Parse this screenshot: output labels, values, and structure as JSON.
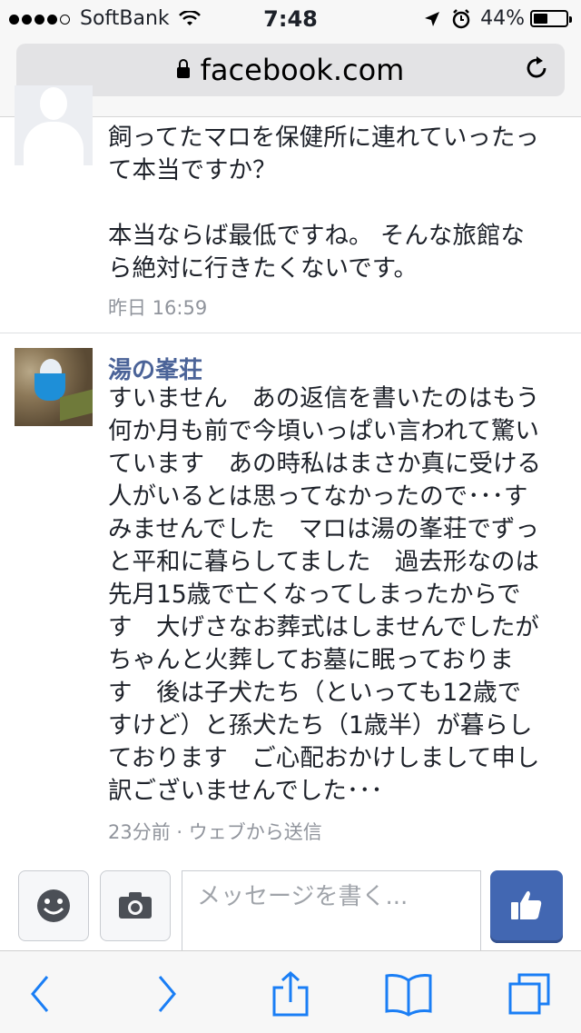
{
  "status_bar": {
    "carrier": "SoftBank",
    "time": "7:48",
    "battery_text": "44%",
    "battery_level": 0.44
  },
  "address_bar": {
    "url": "facebook.com"
  },
  "comments": [
    {
      "author": "",
      "text": "飼ってたマロを保健所に連れていったっ\nて本当ですか？\n\n本当ならば最低ですね。 そんな旅館な\nら絶対に行きたくないです。",
      "meta": "昨日 16:59"
    },
    {
      "author": "湯の峯荘",
      "text": "すいません　あの返信を書いたのはもう\n何か月も前で今頃いっぱい言われて驚い\nています　あの時私はまさか真に受ける\n人がいるとは思ってなかったので･･･す\nみませんでした　マロは湯の峯荘でずっ\nと平和に暮らしてました　過去形なのは\n先月15歳で亡くなってしまったからで\nす　大げさなお葬式はしませんでしたが\nちゃんと火葬してお墓に眠っておりま\nす　後は子犬たち（といっても12歳で\nすけど）と孫犬たち（1歳半）が暮らし\nております　ご心配おかけしまして申し\n訳ございませんでした･･･",
      "meta": "23分前 · ウェブから送信"
    }
  ],
  "composer": {
    "placeholder": "メッセージを書く..."
  },
  "colors": {
    "author": "#4b6398",
    "like_button": "#4267b2",
    "toolbar_icon": "#1a7ef5"
  }
}
